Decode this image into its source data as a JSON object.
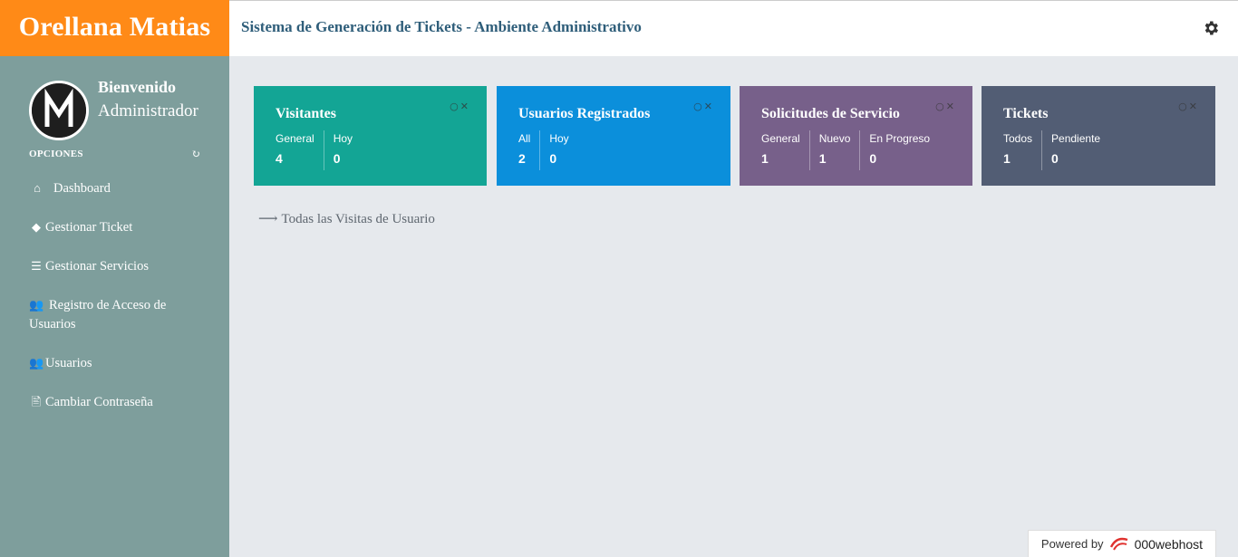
{
  "brand": {
    "name": "Orellana Matias"
  },
  "header": {
    "title": "Sistema de Generación de Tickets - Ambiente Administrativo",
    "settings_icon": "gear-icon"
  },
  "sidebar": {
    "welcome": "Bienvenido",
    "role": "Administrador",
    "options_label": "OPCIONES",
    "items": [
      {
        "label": "Dashboard",
        "icon": "home-icon"
      },
      {
        "label": "Gestionar Ticket",
        "icon": "tag-icon"
      },
      {
        "label": "Gestionar Servicios",
        "icon": "list-icon"
      },
      {
        "label": "Registro de Acceso de Usuarios",
        "icon": "users-icon"
      },
      {
        "label": "Usuarios",
        "icon": "users-icon"
      },
      {
        "label": "Cambiar Contraseña",
        "icon": "file-icon"
      }
    ]
  },
  "cards": [
    {
      "title": "Visitantes",
      "color": "#13a595",
      "stats": [
        {
          "label": "General",
          "value": "4"
        },
        {
          "label": "Hoy",
          "value": "0"
        }
      ]
    },
    {
      "title": "Usuarios Registrados",
      "color": "#0b8fdb",
      "stats": [
        {
          "label": "All",
          "value": "2"
        },
        {
          "label": "Hoy",
          "value": "0"
        }
      ]
    },
    {
      "title": "Solicitudes de Servicio",
      "color": "#77608a",
      "stats": [
        {
          "label": "General",
          "value": "1"
        },
        {
          "label": "Nuevo",
          "value": "1"
        },
        {
          "label": "En Progreso",
          "value": "0"
        }
      ]
    },
    {
      "title": "Tickets",
      "color": "#525d74",
      "stats": [
        {
          "label": "Todos",
          "value": "1"
        },
        {
          "label": "Pendiente",
          "value": "0"
        }
      ]
    }
  ],
  "main": {
    "visits_link": "Todas las Visitas de Usuario"
  },
  "footer": {
    "powered_by": "Powered by",
    "host": "000webhost"
  }
}
